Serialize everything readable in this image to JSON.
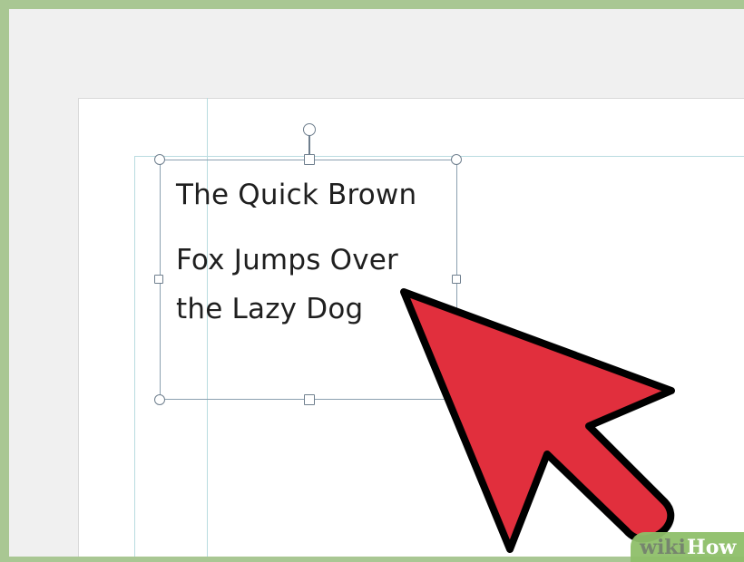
{
  "document": {
    "textbox_lines": [
      "The Quick Brown",
      "Fox Jumps Over",
      "the Lazy Dog"
    ]
  },
  "watermark": {
    "wiki": "wiki",
    "how": "How"
  },
  "colors": {
    "frame_green": "#a9c793",
    "workspace_gray": "#f0f0f0",
    "guide_blue": "#b9dce0",
    "handle_gray": "#6f7f8e",
    "cursor_red": "#e12f3d",
    "cursor_outline": "#000000"
  },
  "icons": {
    "cursor": "arrow-pointer-icon",
    "rotate_handle": "rotation-handle-icon",
    "resize_handle": "resize-handle-icon"
  }
}
